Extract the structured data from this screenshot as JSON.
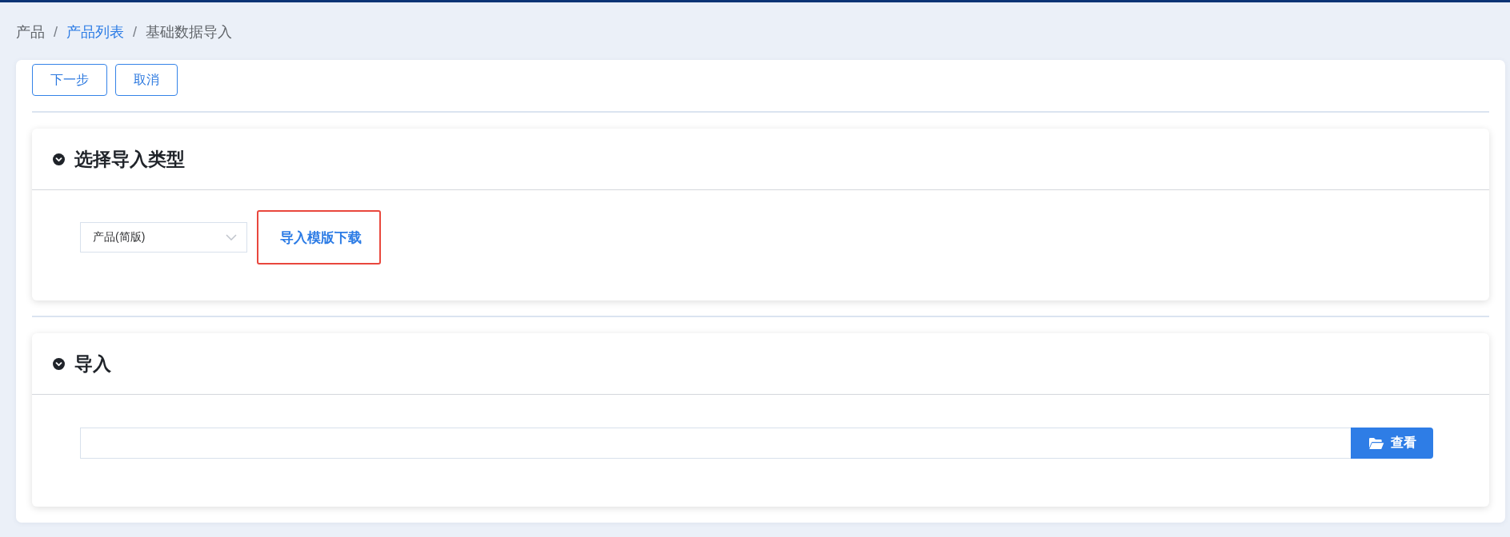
{
  "breadcrumb": [
    {
      "label": "产品",
      "kind": "text"
    },
    {
      "separator": "/",
      "label": "产品列表",
      "kind": "link"
    },
    {
      "separator": "/",
      "label": "基础数据导入",
      "kind": "text"
    }
  ],
  "toolbar": {
    "buttons": [
      "下一步",
      "取消"
    ]
  },
  "sections": [
    {
      "kind": "type-select",
      "title": "选择导入类型",
      "expanded": true,
      "select": {
        "value": "产品(简版)"
      },
      "link": {
        "label": "导入模版下载",
        "highlighted": true
      }
    },
    {
      "kind": "file-import",
      "title": "导入",
      "expanded": true,
      "button": {
        "label": "查看"
      }
    }
  ]
}
